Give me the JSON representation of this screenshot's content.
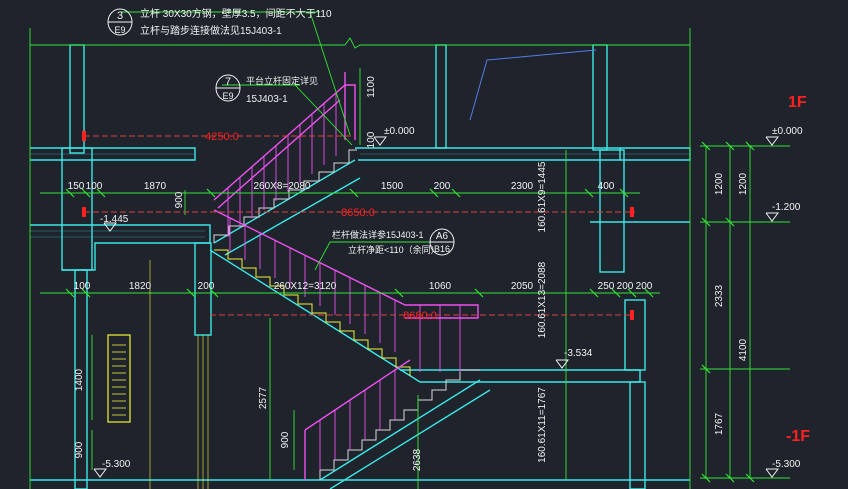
{
  "app": {
    "background": "#1e232c"
  },
  "colors": {
    "wall": "#3ce6e6",
    "dim": "#33e633",
    "rail": "#f050f0",
    "red": "#ff2020",
    "yellow": "#f2f23a",
    "white": "#f2f2f2",
    "dashed_red": "#e04040"
  },
  "callouts": {
    "c1": {
      "num": "3",
      "sheet": "E9",
      "line1": "立杆 30X30方钢，壁厚3.5，间距不大于110",
      "line2": "立杆与踏步连接做法见15J403-1"
    },
    "c2": {
      "num": "7",
      "sheet": "E9",
      "line1": "平台立杆固定详见",
      "line2": "15J403-1"
    },
    "c3": {
      "num": "A6",
      "sheet": "B16",
      "line1": "栏杆做法详参15J403-1",
      "line2": "立杆净距<110（余同）"
    }
  },
  "floors": {
    "upper": "1F",
    "lower": "-1F"
  },
  "elevations": {
    "e0": "±0.000",
    "e0_right": "±0.000",
    "e1_left": "-1.445",
    "e1_right": "-1.200",
    "e2": "-3.534",
    "e3_left": "-5.300",
    "e3_right": "-5.300"
  },
  "dims_row1": {
    "d1": "150",
    "d2": "100",
    "d3": "1870",
    "d4": "260X8=2080",
    "d5": "1500",
    "d6": "200",
    "d7": "2300",
    "d8": "400"
  },
  "dims_row2": {
    "d1": "100",
    "d2": "1820",
    "d3": "200",
    "d4": "260X12=3120",
    "d5": "1060",
    "d6": "2050",
    "d7": "250",
    "d8": "200",
    "d9": "200"
  },
  "red_dims": {
    "r1": "4250.0",
    "r2": "8650.0",
    "r3": "8680.0"
  },
  "vertical_dims": {
    "rail_h": "1100",
    "rail_h2": "100",
    "h_900_top": "900",
    "flight_a": "160.61X9=1445",
    "flight_b": "160.61X13=2088",
    "flight_c": "160.61X11=1767",
    "h_1400": "1400",
    "h_900_left": "900",
    "h_2577": "2577",
    "h_900_mid": "900",
    "h_2638": "2638",
    "right_1200a": "1200",
    "right_1200b": "1200",
    "right_2333": "2333",
    "right_4100": "4100",
    "right_1767": "1767"
  }
}
